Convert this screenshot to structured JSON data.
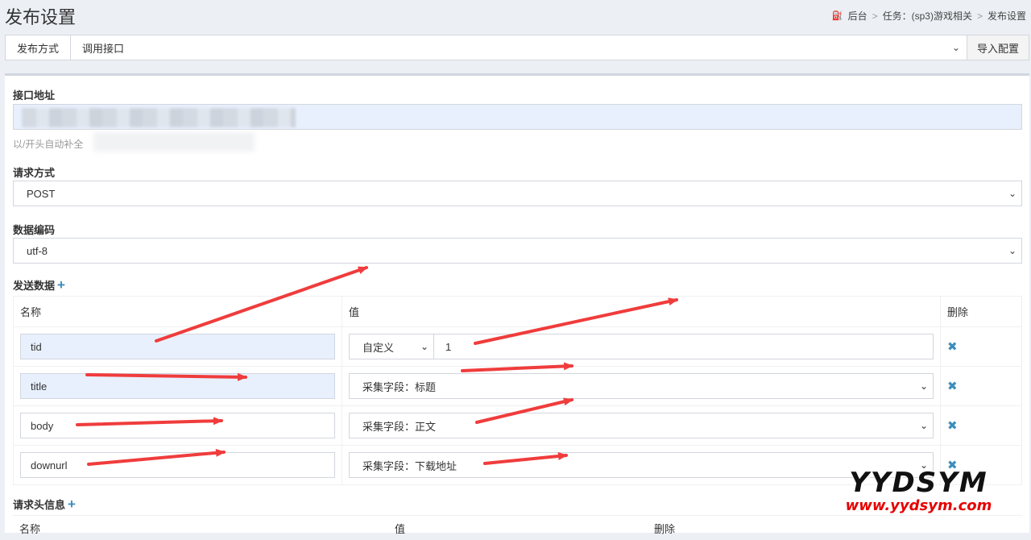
{
  "page": {
    "title": "发布设置"
  },
  "breadcrumb": {
    "items": [
      "后台",
      "任务：(sp3)游戏相关",
      "发布设置"
    ],
    "home_icon": "dashboard-icon"
  },
  "publish": {
    "label": "发布方式",
    "value": "调用接口",
    "import_button": "导入配置"
  },
  "api": {
    "label": "接口地址",
    "hint": "以/开头自动补全"
  },
  "method": {
    "label": "请求方式",
    "value": "POST"
  },
  "encoding": {
    "label": "数据编码",
    "value": "utf-8"
  },
  "send_data": {
    "label": "发送数据",
    "columns": {
      "name": "名称",
      "value": "值",
      "delete": "删除"
    },
    "rows": [
      {
        "name": "tid",
        "type": "自定义",
        "value": "1"
      },
      {
        "name": "title",
        "value": "采集字段：标题"
      },
      {
        "name": "body",
        "value": "采集字段：正文"
      },
      {
        "name": "downurl",
        "value": "采集字段：下载地址"
      }
    ]
  },
  "headers_info": {
    "label": "请求头信息",
    "columns": {
      "name": "名称",
      "value": "值",
      "delete": "删除"
    }
  },
  "watermark": {
    "brand": "YYDSYM",
    "url": "www.yydsym.com"
  },
  "colors": {
    "accent": "#3c8dbc",
    "arrow": "#f03c3c",
    "autofill": "#e8f0fe"
  }
}
